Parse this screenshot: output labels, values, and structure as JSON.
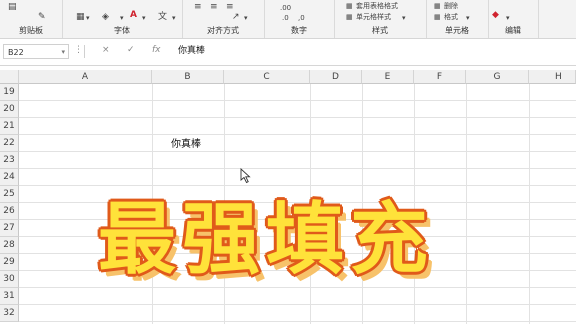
{
  "ribbon": {
    "groups": [
      {
        "label": "剪贴板"
      },
      {
        "label": "字体"
      },
      {
        "label": "对齐方式"
      },
      {
        "label": "数字"
      },
      {
        "label": "样式"
      },
      {
        "label": "单元格"
      },
      {
        "label": "编辑"
      }
    ],
    "style_items": [
      "套用表格格式",
      "单元格样式"
    ],
    "cell_items": [
      "删除",
      "格式"
    ],
    "font_color_glyph": "A",
    "wen_glyph": "文"
  },
  "formula_bar": {
    "name_box": "B22",
    "cancel_glyph": "×",
    "confirm_glyph": "✓",
    "fx_glyph": "fx",
    "content": "你真棒"
  },
  "grid": {
    "columns": [
      "A",
      "B",
      "C",
      "D",
      "E",
      "F",
      "G",
      "H"
    ],
    "rows": [
      "19",
      "20",
      "21",
      "22",
      "23",
      "24",
      "25",
      "26",
      "27",
      "28",
      "29",
      "30",
      "31",
      "32"
    ],
    "cell_b22": "你真棒"
  },
  "overlay": {
    "caption": "最强填充",
    "colors": {
      "fill": "#ffe23a",
      "outline": "#e05a1a",
      "shadow": "#f7c26a"
    }
  }
}
